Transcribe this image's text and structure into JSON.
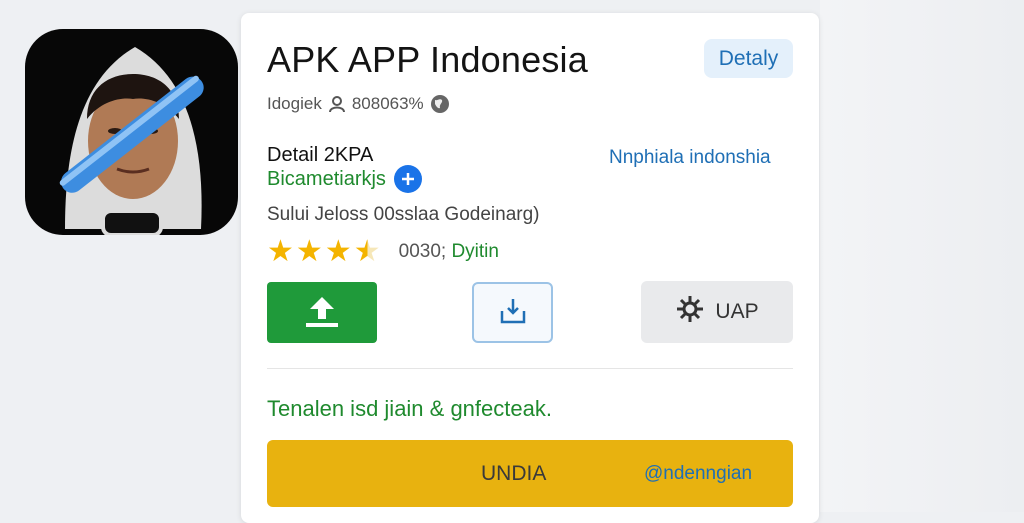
{
  "app": {
    "title": "APK APP Indonesia",
    "details_label": "Detaly",
    "meta_text": "Idogiek",
    "meta_count": "808063%",
    "detail_label": "Detail 2KPA",
    "developer": "Bicametiarkjs",
    "category": "Nnphiala indonshia",
    "subtitle": "Sului  Jeloss  00sslaa  Godeinarg)",
    "rating": 3.5,
    "rating_count": "0030;",
    "rating_suffix": "Dyitin",
    "uap_label": "UAP",
    "tagline": "Tenalen isd jiain & gnfecteak.",
    "cta_label": "UNDIA",
    "cta_handle": "@ndenngian"
  },
  "colors": {
    "accent_green": "#1f9a3a",
    "link_blue": "#1f6fb5",
    "cta_yellow": "#e8b20f",
    "star": "#f4b400"
  },
  "icons": {
    "app_icon": "app-icon-person-with-stripe",
    "upload": "upload-icon",
    "save": "save-tray-icon",
    "gear": "gear-icon",
    "plus": "plus-icon",
    "person": "person-icon",
    "globe": "globe-icon"
  }
}
